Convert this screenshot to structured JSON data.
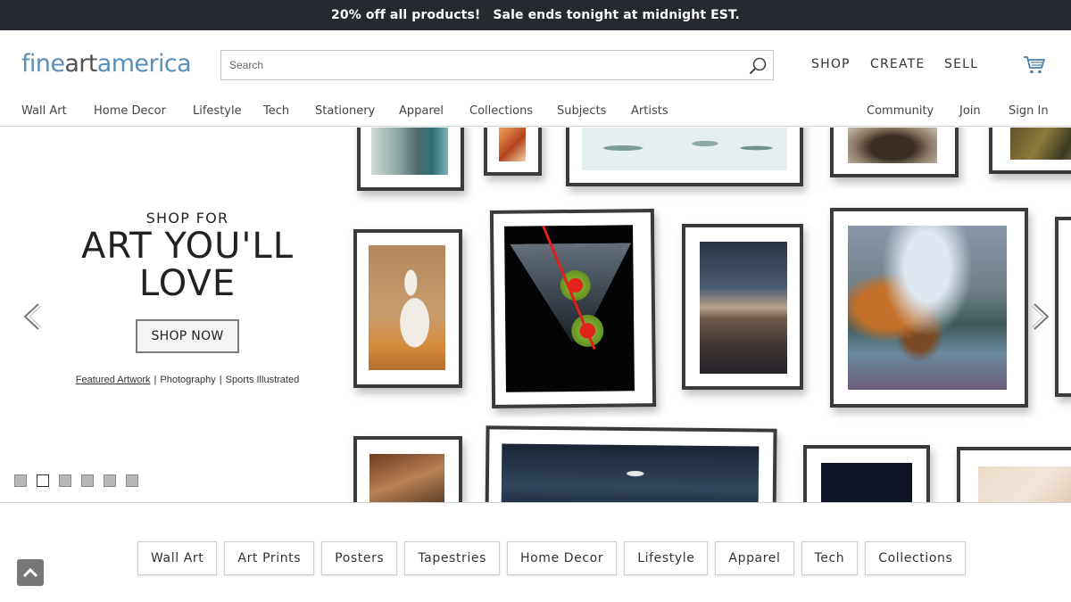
{
  "promo": {
    "text1": "20% off all products!",
    "text2": "Sale ends tonight at midnight EST."
  },
  "header": {
    "logo": {
      "part1": "fine",
      "part2": "art",
      "part3": "america"
    },
    "search_placeholder": "Search",
    "top_links": [
      "SHOP",
      "CREATE",
      "SELL"
    ],
    "cart_icon": "shopping-cart-icon"
  },
  "nav": {
    "items": [
      "Wall Art",
      "Home Decor",
      "Lifestyle",
      "Tech",
      "Stationery",
      "Apparel",
      "Collections",
      "Subjects",
      "Artists"
    ],
    "right_items": [
      "Community",
      "Join",
      "Sign In"
    ]
  },
  "hero": {
    "subtitle": "SHOP FOR",
    "title_line1": "ART YOU'LL",
    "title_line2": "LOVE",
    "cta": "SHOP NOW",
    "links": [
      "Featured Artwork",
      "Photography",
      "Sports Illustrated"
    ],
    "separator": "|",
    "slide_count": 6,
    "active_slide": 2
  },
  "categories": [
    "Wall Art",
    "Art Prints",
    "Posters",
    "Tapestries",
    "Home Decor",
    "Lifestyle",
    "Apparel",
    "Tech",
    "Collections"
  ],
  "colors": {
    "promo_bg": "#262a30",
    "logo_blue": "#5a8fb8",
    "frame": "#3a3a3a"
  }
}
